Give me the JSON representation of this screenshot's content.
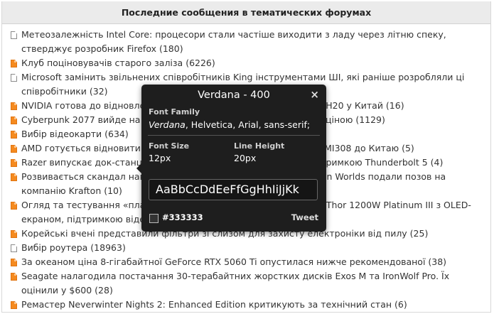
{
  "forum": {
    "title": "Последние сообщения в тематических форумах",
    "posts": [
      {
        "icon": "doc-icon",
        "hot": false,
        "text": "Метеозалежність Intel Core: процесори стали частіше виходити з ладу через літню спеку, стверджує розробник Firefox (180)"
      },
      {
        "icon": "hot-doc-icon",
        "hot": true,
        "text": "Клуб поціновувачів старого заліза (6226)"
      },
      {
        "icon": "doc-icon",
        "hot": false,
        "text": "Microsoft замінить звільнених співробітників King інструментами ШІ, які раніше розробляли ці співробітники (32)"
      },
      {
        "icon": "hot-doc-icon",
        "hot": true,
        "text": "NVIDIA готова до відновлення поставок прискорювачів ШІ-чипів H20 у Китай (16)"
      },
      {
        "icon": "hot-doc-icon",
        "hot": true,
        "text": "Cyberpunk 2077 вийде на консолі Nintendo Switch 2 за помірною ціною (1129)"
      },
      {
        "icon": "hot-doc-icon",
        "hot": true,
        "text": "Вибір відеокарти (634)"
      },
      {
        "icon": "hot-doc-icon",
        "hot": true,
        "text": "AMD готується відновити постачання ШІ-прискорювачів Instinct MI308 до Китаю (5)"
      },
      {
        "icon": "hot-doc-icon",
        "hot": true,
        "text": "Razer випускає док-станцію та зовнішній відеокарт Core X з підтримкою Thunderbolt 5 (4)"
      },
      {
        "icon": "hot-doc-icon",
        "hot": true,
        "text": "Розвивається скандал навколо Subnautica 2: засновники Unknown Worlds подали позов на компанію Krafton (10)"
      },
      {
        "icon": "hot-doc-icon",
        "hot": true,
        "text": "Огляд та тестування «платинового» блока живлення ASUS ROG Thor 1200W Platinum III з OLED-екраном, підтримкою відеокарт з потужністю 1200 Вт (8)"
      },
      {
        "icon": "hot-doc-icon",
        "hot": true,
        "text": "Корейські вчені представили фільтри зі слизом для захисту електроніки від пилу (25)"
      },
      {
        "icon": "doc-icon",
        "hot": false,
        "text": "Вибір роутера (18963)"
      },
      {
        "icon": "hot-doc-icon",
        "hot": true,
        "text": "За океаном ціна 8-гігабайтної GeForce RTX 5060 Ti опустилася нижче рекомендованої (38)"
      },
      {
        "icon": "hot-doc-icon",
        "hot": true,
        "text": "Seagate налагодила постачання 30-терабайтних жорстких дисків Exos M та IronWolf Pro. Їх оцінили у $600 (28)"
      },
      {
        "icon": "hot-doc-icon",
        "hot": true,
        "text": "Ремастер Neverwinter Nights 2: Enhanced Edition критикують за технічний стан (6)"
      }
    ]
  },
  "font_tooltip": {
    "title": "Verdana - 400",
    "close": "×",
    "family_label": "Font Family",
    "family_primary": "Verdana",
    "family_rest": ", Helvetica, Arial, sans-serif;",
    "size_label": "Font Size",
    "size_value": "12px",
    "line_height_label": "Line Height",
    "line_height_value": "20px",
    "sample": "AaBbCcDdEeFfGgHhIiJjKk",
    "color_hex": "#333333",
    "tweet_label": "Tweet"
  },
  "colors": {
    "header_bg": "#ebebeb",
    "hot_icon": "#f58a1f",
    "tooltip_bg": "#1e1e1e",
    "text": "#333333"
  }
}
